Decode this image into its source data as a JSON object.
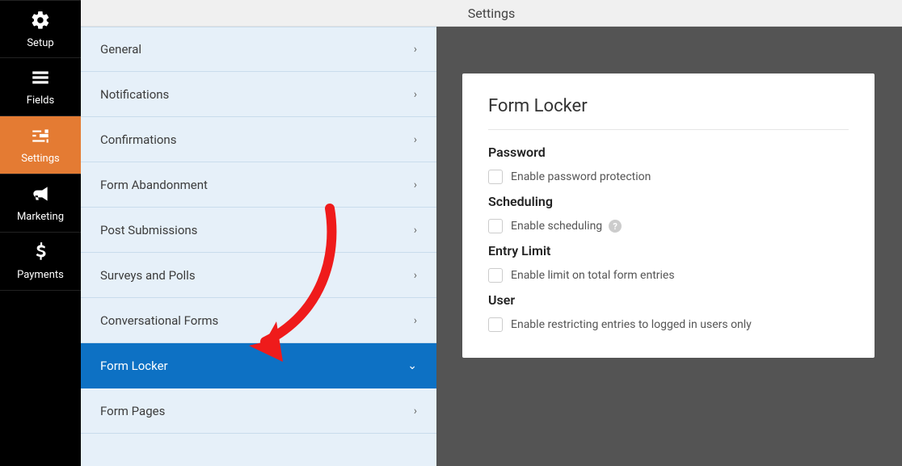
{
  "header": {
    "title": "Settings"
  },
  "nav": {
    "items": [
      {
        "label": "Setup"
      },
      {
        "label": "Fields"
      },
      {
        "label": "Settings"
      },
      {
        "label": "Marketing"
      },
      {
        "label": "Payments"
      }
    ]
  },
  "settings_list": {
    "items": [
      {
        "label": "General"
      },
      {
        "label": "Notifications"
      },
      {
        "label": "Confirmations"
      },
      {
        "label": "Form Abandonment"
      },
      {
        "label": "Post Submissions"
      },
      {
        "label": "Surveys and Polls"
      },
      {
        "label": "Conversational Forms"
      },
      {
        "label": "Form Locker"
      },
      {
        "label": "Form Pages"
      }
    ]
  },
  "panel": {
    "title": "Form Locker",
    "sections": {
      "password": {
        "title": "Password",
        "checkbox_label": "Enable password protection"
      },
      "scheduling": {
        "title": "Scheduling",
        "checkbox_label": "Enable scheduling"
      },
      "entry_limit": {
        "title": "Entry Limit",
        "checkbox_label": "Enable limit on total form entries"
      },
      "user": {
        "title": "User",
        "checkbox_label": "Enable restricting entries to logged in users only"
      }
    }
  }
}
